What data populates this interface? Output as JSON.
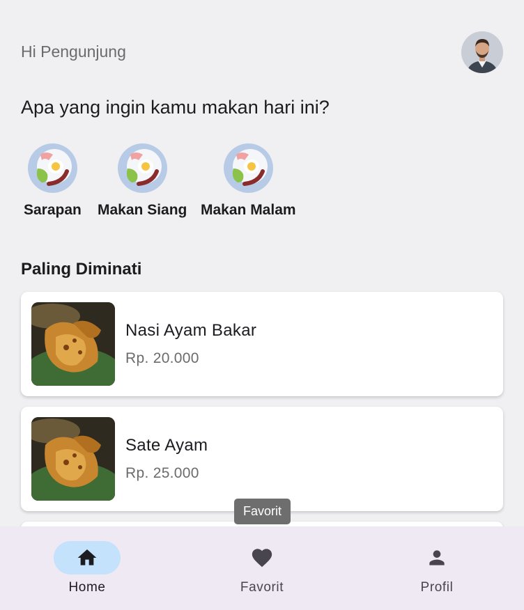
{
  "header": {
    "greeting": "Hi Pengunjung",
    "question": "Apa yang ingin kamu makan hari ini?"
  },
  "categories": [
    {
      "label": "Sarapan",
      "icon": "breakfast-plate-icon"
    },
    {
      "label": "Makan Siang",
      "icon": "breakfast-plate-icon"
    },
    {
      "label": "Makan Malam",
      "icon": "breakfast-plate-icon"
    }
  ],
  "popular": {
    "title": "Paling Diminati",
    "items": [
      {
        "name": "Nasi Ayam Bakar",
        "price": "Rp. 20.000"
      },
      {
        "name": "Sate Ayam",
        "price": "Rp. 25.000"
      }
    ]
  },
  "tooltip": {
    "text": "Favorit"
  },
  "nav": {
    "items": [
      {
        "label": "Home",
        "icon": "home-icon",
        "active": true
      },
      {
        "label": "Favorit",
        "icon": "heart-icon",
        "active": false
      },
      {
        "label": "Profil",
        "icon": "person-icon",
        "active": false
      }
    ]
  },
  "colors": {
    "background": "#f0f0f3",
    "nav_background": "#efe9f4",
    "nav_active_indicator": "#c4e2fb",
    "category_circle": "#b7cbe6"
  }
}
